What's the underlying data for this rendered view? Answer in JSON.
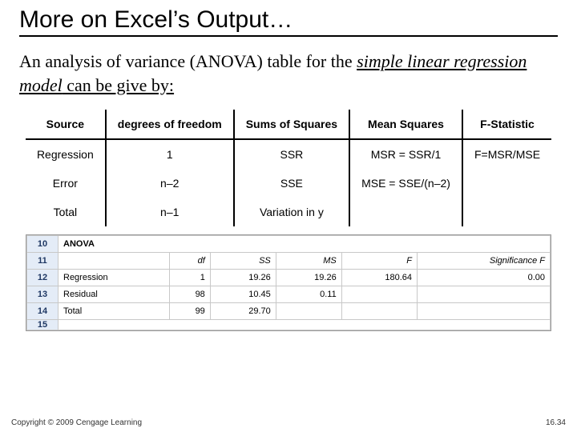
{
  "title": "More on Excel’s Output…",
  "intro_prefix": "An analysis of variance (ANOVA) table for the ",
  "intro_em": "simple linear regression model",
  "intro_suffix": " can be give by:",
  "formula_table": {
    "headers": [
      "Source",
      "degrees of freedom",
      "Sums of Squares",
      "Mean Squares",
      "F-Statistic"
    ],
    "rows": [
      {
        "src": "Regression",
        "df": "1",
        "ss": "SSR",
        "ms": "MSR = SSR/1",
        "f": "F=MSR/MSE"
      },
      {
        "src": "Error",
        "df": "n–2",
        "ss": "SSE",
        "ms": "MSE = SSE/(n–2)",
        "f": ""
      },
      {
        "src": "Total",
        "df": "n–1",
        "ss": "Variation in y",
        "ms": "",
        "f": ""
      }
    ]
  },
  "excel": {
    "rownums": [
      "10",
      "11",
      "12",
      "13",
      "14",
      "15"
    ],
    "anova_label": "ANOVA",
    "headers": [
      "df",
      "SS",
      "MS",
      "F",
      "Significance F"
    ],
    "rows": [
      {
        "label": "Regression",
        "df": "1",
        "ss": "19.26",
        "ms": "19.26",
        "f": "180.64",
        "sig": "0.00"
      },
      {
        "label": "Residual",
        "df": "98",
        "ss": "10.45",
        "ms": "0.11",
        "f": "",
        "sig": ""
      },
      {
        "label": "Total",
        "df": "99",
        "ss": "29.70",
        "ms": "",
        "f": "",
        "sig": ""
      }
    ]
  },
  "footer_left": "Copyright © 2009 Cengage Learning",
  "footer_right": "16.34"
}
